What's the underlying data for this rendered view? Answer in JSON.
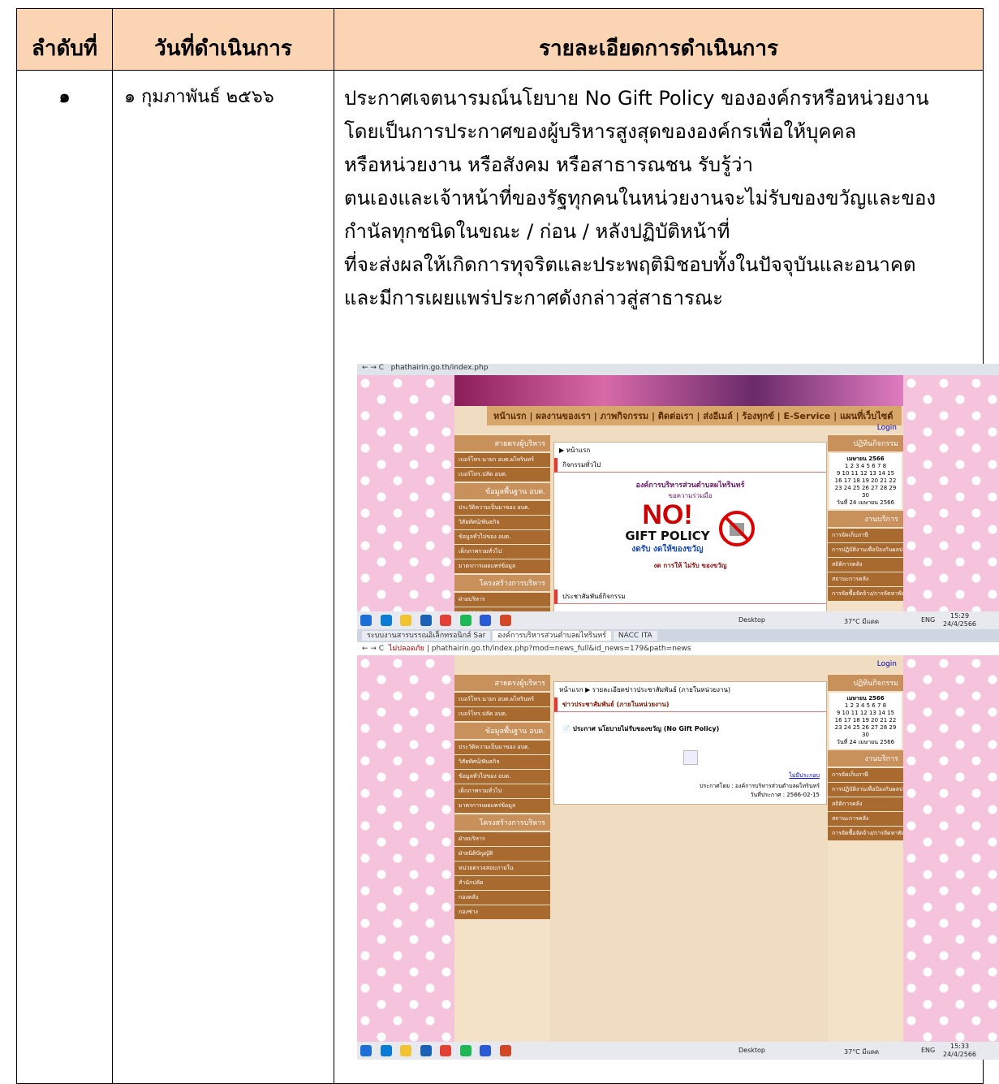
{
  "table": {
    "headers": [
      "ลำดับที่",
      "วันที่ดำเนินการ",
      "รายละเอียดการดำเนินการ"
    ],
    "row": {
      "number": "๑",
      "date": "๑ กุมภาพันธ์ ๒๕๖๖",
      "lines": [
        "ประกาศเจตนารมณ์นโยบาย No Gift Policy ขององค์กรหรือหน่วยงาน",
        "โดยเป็นการประกาศของผู้บริหารสูงสุดขององค์กรเพื่อให้บุคคล",
        "หรือหน่วยงาน หรือสังคม หรือสาธารณชน รับรู้ว่า",
        "ตนเองและเจ้าหน้าที่ของรัฐทุกคนในหน่วยงานจะไม่รับของขวัญและของ",
        "กำนัลทุกชนิดในขณะ / ก่อน / หลังปฏิบัติหน้าที่",
        "ที่จะส่งผลให้เกิดการทุจริตและประพฤติมิชอบทั้งในปัจจุบันและอนาคต",
        "และมีการเผยแพร่ประกาศดังกล่าวสู่สาธารณะ"
      ]
    }
  },
  "shot1": {
    "url": "phathairin.go.th/index.php",
    "nav": [
      "หน้าแรก",
      "ผลงานของเรา",
      "ภาพกิจกรรม",
      "ติดต่อเรา",
      "ส่งอีเมล์",
      "ร้องทุกข์",
      "E-Service",
      "แผนที่เว็บไซต์"
    ],
    "login": "Login",
    "breadcrumb": "หน้าแรก",
    "section": "กิจกรรมทั่วไป",
    "org": "องค์การบริหารส่วนตำบลผไทรินทร์",
    "coop": "ขอความร่วมมือ",
    "no": "NO!",
    "gift_policy": "GIFT POLICY",
    "slogan": "งดรับ งดให้ของขวัญ",
    "slogan2": "งด การให้ ไม่รับ ของขวัญ",
    "footer_section": "ประชาสัมพันธ์กิจกรรม",
    "cal_month": "เมษายน 2566",
    "cal_today": "วันที่ 24 เมษายน 2566",
    "taskbar_desktop": "Desktop",
    "temp": "37°C มีแดด",
    "lang": "ENG",
    "time": "15:29",
    "date": "24/4/2566"
  },
  "shot2": {
    "tabs": [
      "ระบบงานสารบรรณอิเล็กทรอนิกส์ Sar",
      "องค์การบริหารส่วนตำบลผไทรินทร์",
      "NACC ITA"
    ],
    "url": "phathairin.go.th/index.php?mod=news_full&id_news=179&path=news",
    "security": "ไม่ปลอดภัย",
    "breadcrumb": "หน้าแรก ▶ รายละเอียดข่าวประชาสัมพันธ์ (ภายในหน่วยงาน)",
    "section": "ข่าวประชาสัมพันธ์ (ภายในหน่วยงาน)",
    "item": "ประกาศ นโยบายไม่รับของขวัญ (No Gift Policy)",
    "print": "ไม่มีประกอบ",
    "announced_by": "ประกาศโดย : องค์การบริหารส่วนตำบลผไทรินทร์",
    "announced_date": "วันที่ประกาศ : 2566-02-15",
    "cal_month": "เมษายน 2566",
    "cal_today": "วันที่ 24 เมษายน 2566",
    "time": "15:33",
    "date": "24/4/2566",
    "temp": "37°C มีแดด",
    "taskbar_desktop": "Desktop",
    "lang": "ENG"
  },
  "sidebar_heads": [
    "สายตรงผู้บริหาร",
    "ข้อมูลพื้นฐาน อบต.",
    "โครงสร้างการบริหาร"
  ],
  "sidebar_items": [
    "เบอร์โทร.นายก อบต.ผไทรินทร์",
    "เบอร์โทร.ปลัด อบต.",
    "ประวัติความเป็นมาของ อบต.",
    "วิสัยทัศน์/พันธกิจ",
    "ข้อมูลทั่วไปของ อบต.",
    "เด็กภาพรวมทั่วไป",
    "มาตรการเผยแพร่ข้อมูล"
  ],
  "sidebar_items2": [
    "ฝ่ายบริหาร",
    "ฝ่ายนิติบัญญัติ",
    "หน่วยตรวจสอบภายใน",
    "สำนักปลัด",
    "กองคลัง",
    "กองช่าง"
  ],
  "right_heads": [
    "ปฏิทินกิจกรรม",
    "งานบริการ"
  ],
  "right_items": [
    "การจัดเก็บภาษี",
    "การปฏิบัติงานเพื่อป้องกันผลประโยชน์ทับซ้อน",
    "สถิติการคลัง",
    "สถานะการคลัง",
    "การจัดซื้อจัดจ้าง/การจัดหาพัสดุ"
  ]
}
